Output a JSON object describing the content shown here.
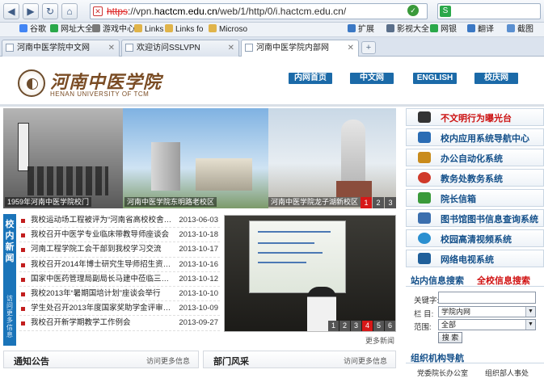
{
  "browser": {
    "address": {
      "protocol": "https",
      "rest_before": "://vpn.",
      "host": "hactcm.edu.cn",
      "path": "/web/1/http/0/i.hactcm.edu.cn/"
    },
    "bookmarks": [
      "谷歌",
      "网址大全",
      "游戏中心",
      "Links",
      "Links fo",
      "Microso",
      "扩展",
      "影视大全",
      "网银",
      "翻译",
      "截图"
    ],
    "tabs": [
      {
        "title": "河南中医学院中文网"
      },
      {
        "title": "欢迎访问SSLVPN"
      },
      {
        "title": "河南中医学院内部网"
      }
    ],
    "new_tab": "+"
  },
  "header": {
    "logo_cn": "河南中医学院",
    "logo_en": "HENAN UNIVERSITY OF TCM",
    "nav": [
      "内网首页",
      "中文网",
      "ENGLISH",
      "校庆网"
    ]
  },
  "banner": {
    "captions": [
      "1959年河南中医学院校门",
      "河南中医学院东明路老校区",
      "河南中医学院龙子湖新校区"
    ],
    "pager": [
      "1",
      "2",
      "3"
    ],
    "active_page": "1"
  },
  "news": {
    "side_label": "校内新闻",
    "side_more": "访问更多信息",
    "items": [
      {
        "title": "我校运动场工程被评为“河南省高校校舍建设…",
        "date": "2013-06-03"
      },
      {
        "title": "我校召开中医学专业临床带教导师座谈会",
        "date": "2013-10-18"
      },
      {
        "title": "河南工程学院工会干部到我校学习交流",
        "date": "2013-10-17"
      },
      {
        "title": "我校召开2014年博士研究生导师招生资格遴选…",
        "date": "2013-10-16"
      },
      {
        "title": "国家中医药管理局副局长马建中莅临三附院指…",
        "date": "2013-10-12"
      },
      {
        "title": "我校2013年“暑期国培计划”座谈会举行",
        "date": "2013-10-10"
      },
      {
        "title": "学生处召开2013年度国家奖助学金评审工作专…",
        "date": "2013-10-09"
      },
      {
        "title": "我校召开新学期教学工作例会",
        "date": "2013-09-27"
      }
    ]
  },
  "video": {
    "pager": [
      "1",
      "2",
      "3",
      "4",
      "5",
      "6"
    ],
    "active_page": "4",
    "more": "更多新闻"
  },
  "panels": {
    "notice": {
      "title": "通知公告",
      "more": "访问更多信息"
    },
    "dept": {
      "title": "部门风采",
      "more": "访问更多信息"
    }
  },
  "sidebar": {
    "items": [
      {
        "label": "不文明行为曝光台",
        "icon": "camera-icon",
        "color": "#333333"
      },
      {
        "label": "校内应用系统导航中心",
        "icon": "monitor-icon",
        "color": "#2a6cb4"
      },
      {
        "label": "办公自动化系统",
        "icon": "coins-icon",
        "color": "#c98b1c"
      },
      {
        "label": "教务处教务系统",
        "icon": "pie-icon",
        "color": "#d03a2a"
      },
      {
        "label": "院长信箱",
        "icon": "mailbox-icon",
        "color": "#3a9a3a"
      },
      {
        "label": "图书馆图书信息查询系统",
        "icon": "book-icon",
        "color": "#3b6fae"
      },
      {
        "label": "校园高清视频系统",
        "icon": "play-icon",
        "color": "#2a8fd0"
      },
      {
        "label": "网络电视系统",
        "icon": "tv-icon",
        "color": "#1f5f9a"
      }
    ]
  },
  "search": {
    "tab_site": "站内信息搜索",
    "tab_all": "全校信息搜索",
    "keyword_label": "关键字:",
    "keyword_value": "",
    "column_label": "栏 目:",
    "column_value": "学院内网",
    "scope_label": "范围:",
    "scope_value": "全部",
    "button": "搜 索"
  },
  "org": {
    "title": "组织机构导航",
    "links": [
      "党委院长办公室",
      "组织部人事处"
    ]
  }
}
